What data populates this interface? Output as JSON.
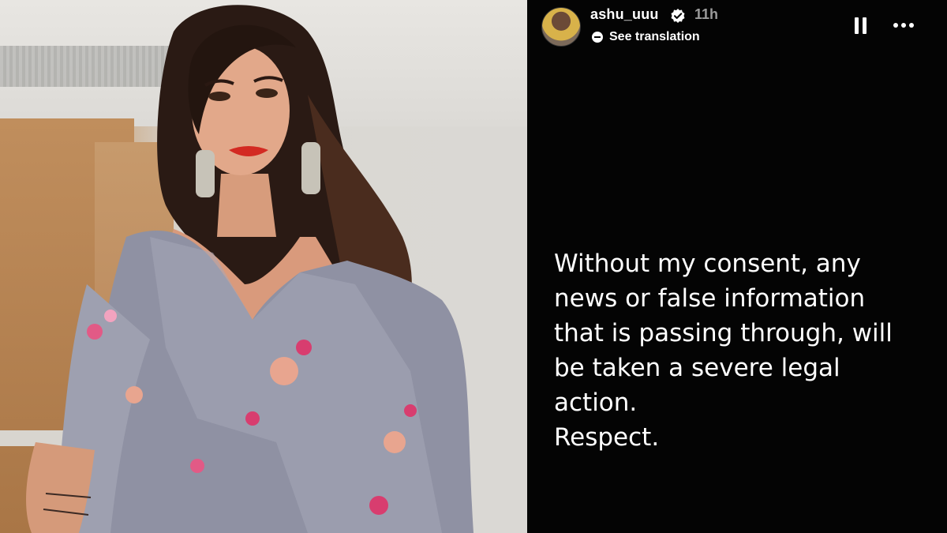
{
  "story": {
    "username": "ashu_uuu",
    "timestamp": "11h",
    "translate_label": "See translation",
    "message": "Without my consent, any\nnews or false information\nthat is passing through, will\nbe taken a severe legal\naction.\nRespect.",
    "background_color": "#040404",
    "text_color": "#ffffff",
    "muted_color": "#9b9b9b"
  },
  "icons": {
    "verified": "verified-badge-icon",
    "translate": "translate-dot-icon",
    "pause": "pause-icon",
    "more": "more-dots-icon"
  },
  "photo": {
    "subject": "woman-in-grey-saree"
  }
}
